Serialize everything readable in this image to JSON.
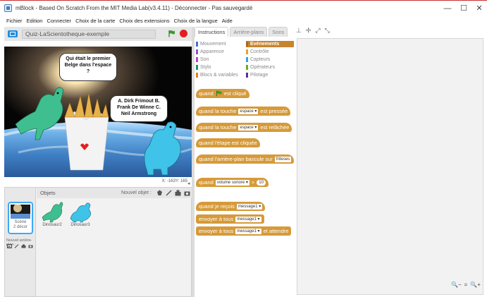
{
  "window": {
    "title": "mBlock - Based On Scratch From the MIT Media Lab(v3.4.11) - Déconnecter - Pas sauvegardé",
    "minimize": "—",
    "maximize": "☐",
    "close": "✕"
  },
  "menu": [
    "Fichier",
    "Edition",
    "Connecter",
    "Choix de la carte",
    "Choix des extensions",
    "Choix de la langue",
    "Aide"
  ],
  "stage": {
    "project_name": "Quiz-LaScientotheque-exemple",
    "bubble_question": "Qui était le premier Belge dans l'espace ?",
    "bubble_answers": "A. Dirk Frimout B. Frank De Winne C. Neil Armstrong",
    "coords": "X: -163Y: 165"
  },
  "sprites": {
    "header": "Objets",
    "new_object": "Nouvel objet :",
    "scene_label": "Scène\n2 décor",
    "new_backdrop": "Nouvel arrière-plan :",
    "items": [
      {
        "name": "Dinosaur2"
      },
      {
        "name": "Dinosaur3"
      }
    ]
  },
  "tabs": [
    "Instructions",
    "Arrière-plans",
    "Sons"
  ],
  "categories": {
    "left": [
      {
        "label": "Mouvement",
        "color": "#4a6cd4"
      },
      {
        "label": "Apparence",
        "color": "#8a55d7"
      },
      {
        "label": "Son",
        "color": "#bb42c3"
      },
      {
        "label": "Stylo",
        "color": "#0e9a6c"
      },
      {
        "label": "Blocs & variables",
        "color": "#ee7d16"
      }
    ],
    "right": [
      {
        "label": "Evénements",
        "color": "#c88330",
        "selected": true
      },
      {
        "label": "Contrôle",
        "color": "#e1a91a"
      },
      {
        "label": "Capteurs",
        "color": "#2ca5e2"
      },
      {
        "label": "Opérateurs",
        "color": "#5cb712"
      },
      {
        "label": "Pilotage",
        "color": "#632d99"
      }
    ]
  },
  "blocks": {
    "when_flag_a": "quand",
    "when_flag_b": "est cliqué",
    "key_pressed_a": "quand la touche",
    "key_pressed_dd": "espace ▾",
    "key_pressed_b": "est pressée",
    "key_released_a": "quand la touche",
    "key_released_dd": "espace ▾",
    "key_released_b": "est relâchée",
    "stage_clicked": "quand l'étape est cliquée",
    "backdrop_switch_a": "quand l'arrière-plan bascule sur",
    "backdrop_switch_dd": "friteses",
    "sensor_a": "quand",
    "sensor_dd": "volume sonore ▾",
    "sensor_op": ">",
    "sensor_num": "10",
    "receive_a": "quand je reçois",
    "receive_dd": "message1 ▾",
    "broadcast_a": "envoyer à tous",
    "broadcast_dd": "message1 ▾",
    "broadcast_wait_a": "envoyer à tous",
    "broadcast_wait_dd": "message1 ▾",
    "broadcast_wait_b": "et attendre"
  },
  "zoom": {
    "out": "🔍−",
    "reset": "=",
    "in": "🔍+"
  },
  "colors": {
    "events": "#d69a3a",
    "accent": "#3fa9f5",
    "stop": "#e21f1f",
    "flag": "#3a9a2e"
  }
}
